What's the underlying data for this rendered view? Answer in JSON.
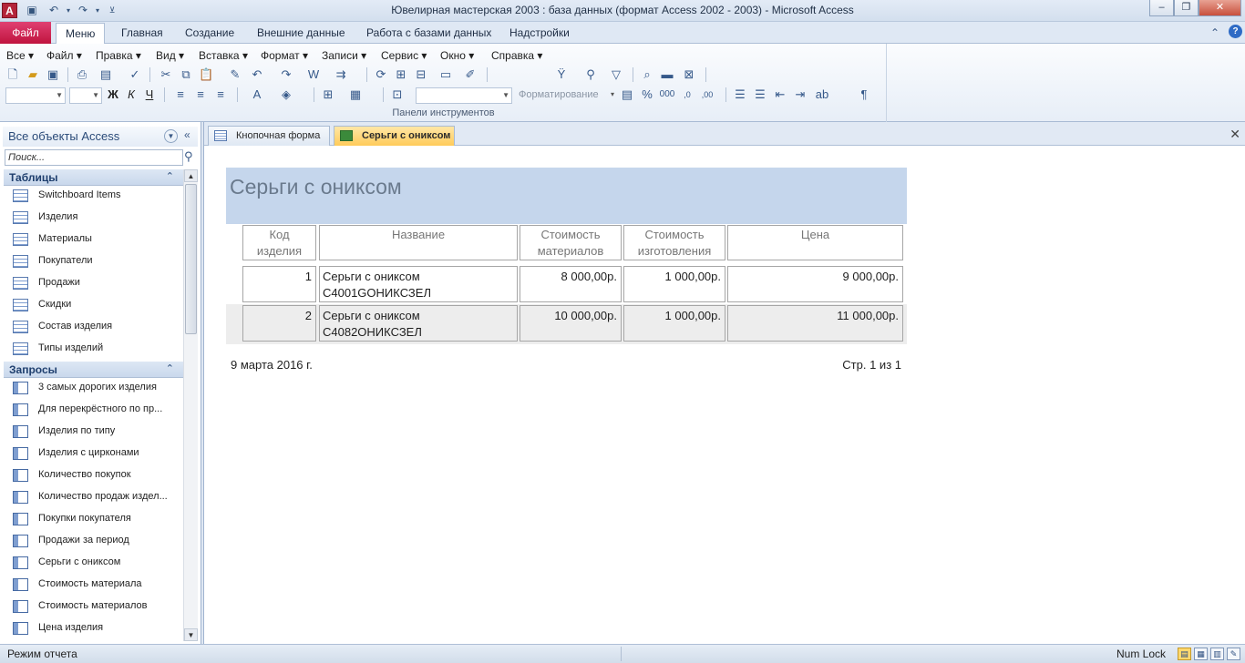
{
  "window": {
    "title": "Ювелирная мастерская 2003 : база данных (формат Access 2002 - 2003)  -  Microsoft Access",
    "app_icon": "A"
  },
  "ribbon_tabs": [
    "Файл",
    "Меню",
    "Главная",
    "Создание",
    "Внешние данные",
    "Работа с базами данных",
    "Надстройки"
  ],
  "menu": [
    "Все",
    "Файл",
    "Правка",
    "Вид",
    "Вставка",
    "Формат",
    "Записи",
    "Сервис",
    "Окно",
    "Справка"
  ],
  "toolbar": {
    "format_combo": "Форматирование",
    "group_label": "Панели инструментов"
  },
  "nav": {
    "header": "Все объекты Access",
    "search_placeholder": "Поиск...",
    "tables_group": "Таблицы",
    "tables": [
      "Switchboard Items",
      "Изделия",
      "Материалы",
      "Покупатели",
      "Продажи",
      "Скидки",
      "Состав изделия",
      "Типы изделий"
    ],
    "queries_group": "Запросы",
    "queries": [
      "3 самых дорогих изделия",
      "Для перекрёстного по пр...",
      "Изделия по типу",
      "Изделия с цирконами",
      "Количество покупок",
      "Количество продаж издел...",
      "Покупки покупателя",
      "Продажи за период",
      "Серьги с ониксом",
      "Стоимость материала",
      "Стоимость материалов",
      "Цена изделия"
    ]
  },
  "doc_tabs": [
    "Кнопочная форма",
    "Серьги с ониксом"
  ],
  "report": {
    "title": "Серьги с ониксом",
    "headers": [
      {
        "l1": "Код",
        "l2": "изделия"
      },
      {
        "l1": "Название",
        "l2": ""
      },
      {
        "l1": "Стоимость",
        "l2": "материалов"
      },
      {
        "l1": "Стоимость",
        "l2": "изготовления"
      },
      {
        "l1": "Цена",
        "l2": ""
      }
    ],
    "rows": [
      {
        "code": "1",
        "name1": "Серьги с ониксом",
        "name2": "С4001GОНИКСЗЕЛ",
        "mat": "8 000,00р.",
        "make": "1 000,00р.",
        "price": "9 000,00р."
      },
      {
        "code": "2",
        "name1": "Серьги с ониксом",
        "name2": "С4082ОНИКСЗЕЛ",
        "mat": "10 000,00р.",
        "make": "1 000,00р.",
        "price": "11 000,00р."
      }
    ],
    "date": "9 марта 2016 г.",
    "page": "Стр. 1 из 1"
  },
  "status": {
    "left": "Режим отчета",
    "right": "Num Lock"
  },
  "colors": {
    "file_tab": "#c0143f",
    "active_doc_tab": "#ffcb5a",
    "report_header": "#c5d6ec"
  }
}
